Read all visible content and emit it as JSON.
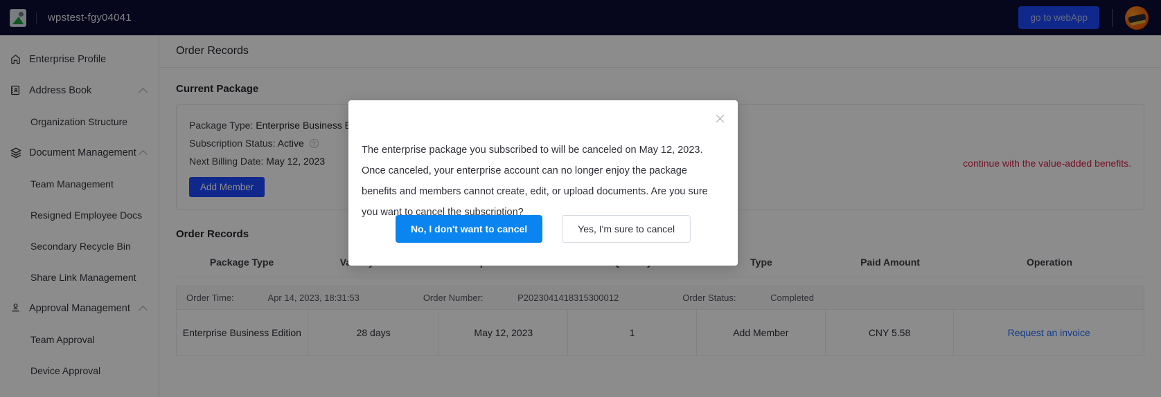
{
  "header": {
    "logo_icon": "wps-document-logo-icon",
    "title": "wpstest-fgy04041",
    "webapp_button": "go to webApp",
    "avatar_icon": "user-avatar"
  },
  "sidebar": {
    "items": [
      {
        "label": "Enterprise Profile",
        "icon": "home-icon",
        "level": "top",
        "expandable": false
      },
      {
        "label": "Address Book",
        "icon": "address-book-icon",
        "level": "top",
        "expandable": true
      },
      {
        "label": "Organization Structure",
        "icon": "",
        "level": "sub",
        "expandable": false
      },
      {
        "label": "Document Management",
        "icon": "layers-icon",
        "level": "top",
        "expandable": true
      },
      {
        "label": "Team Management",
        "icon": "",
        "level": "sub",
        "expandable": false
      },
      {
        "label": "Resigned Employee Docs",
        "icon": "",
        "level": "sub",
        "expandable": false
      },
      {
        "label": "Secondary Recycle Bin",
        "icon": "",
        "level": "sub",
        "expandable": false
      },
      {
        "label": "Share Link Management",
        "icon": "",
        "level": "sub",
        "expandable": false
      },
      {
        "label": "Approval Management",
        "icon": "stamp-icon",
        "level": "top",
        "expandable": true
      },
      {
        "label": "Team Approval",
        "icon": "",
        "level": "sub",
        "expandable": false
      },
      {
        "label": "Device Approval",
        "icon": "",
        "level": "sub",
        "expandable": false
      }
    ]
  },
  "main": {
    "page_title": "Order Records",
    "current_package": {
      "section_title": "Current Package",
      "package_type_label": "Package Type:",
      "package_type_value": "Enterprise Business Edition",
      "subscription_status_label": "Subscription Status:",
      "subscription_status_value": "Active",
      "help_icon": "question-mark-icon",
      "next_billing_label": "Next Billing Date:",
      "next_billing_value": "May 12, 2023",
      "add_member_button": "Add Member",
      "notice_text": "continue with the value-added benefits.",
      "notice_color": "#d6234b"
    },
    "order_records": {
      "section_title": "Order Records",
      "columns": [
        "Package Type",
        "Validity Period",
        "Expiration Date",
        "Quantity",
        "Type",
        "Paid Amount",
        "Operation"
      ],
      "group_header": {
        "order_time_label": "Order Time:",
        "order_time_value": "Apr 14, 2023, 18:31:53",
        "order_number_label": "Order Number:",
        "order_number_value": "P2023041418315300012",
        "order_status_label": "Order Status:",
        "order_status_value": "Completed"
      },
      "rows": [
        {
          "package_type": "Enterprise Business Edition",
          "validity_period": "28 days",
          "expiration_date": "May 12, 2023",
          "quantity": "1",
          "type": "Add Member",
          "paid_amount": "CNY 5.58",
          "operation": "Request an invoice"
        }
      ]
    }
  },
  "modal": {
    "close_icon": "close-icon",
    "message": "The enterprise package you subscribed to will be canceled on May 12, 2023. Once canceled, your enterprise account can no longer enjoy the package benefits and members cannot create, edit, or upload documents. Are you sure you want to cancel the subscription?",
    "confirm_button": "No, I don't want to cancel",
    "cancel_button": "Yes, I'm sure to cancel"
  }
}
